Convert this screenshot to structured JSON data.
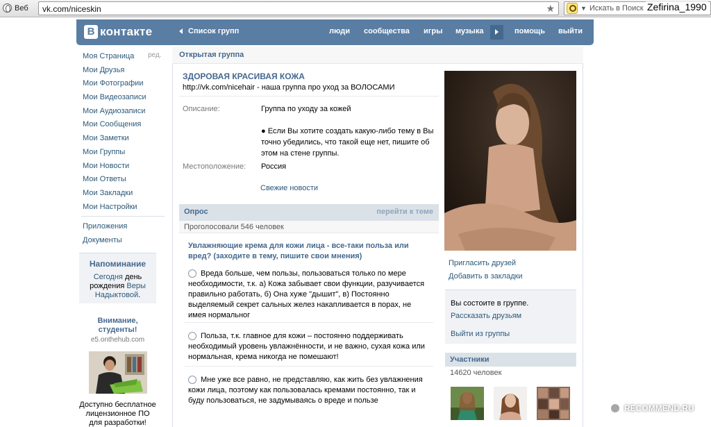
{
  "browser": {
    "web_label": "Веб",
    "url": "vk.com/niceskin",
    "search_placeholder": "Искать в Поиск",
    "user": "Zefirina_1990"
  },
  "header": {
    "logo_text": "контакте",
    "logo_mark": "В",
    "group_list": "Список групп",
    "nav": [
      "люди",
      "сообщества",
      "игры",
      "музыка",
      "помощь",
      "выйти"
    ]
  },
  "sidebar": {
    "edit": "ред.",
    "items": [
      "Моя Страница",
      "Мои Друзья",
      "Мои Фотографии",
      "Мои Видеозаписи",
      "Мои Аудиозаписи",
      "Мои Сообщения",
      "Мои Заметки",
      "Мои Группы",
      "Мои Новости",
      "Мои Ответы",
      "Мои Закладки",
      "Мои Настройки"
    ],
    "items2": [
      "Приложения",
      "Документы"
    ],
    "reminder": {
      "title": "Напоминание",
      "today": "Сегодня",
      "birthday": "день рождения",
      "name": "Веры Надыктовой",
      "dot": "."
    },
    "ad": {
      "title": "Внимание, студенты!",
      "domain": "e5.onthehub.com",
      "text": "Доступно бесплатное лицензионное ПО для разработки!"
    }
  },
  "group": {
    "type": "Открытая группа",
    "title": "ЗДОРОВАЯ КРАСИВАЯ КОЖА",
    "subtitle": "http://vk.com/nicehair - наша группа про уход за ВОЛОСАМИ",
    "description_label": "Описание:",
    "description_1": "Группа по уходу за кожей",
    "description_2": "● Если Вы хотите создать какую-либо тему в Вы точно убедились, что такой еще нет, пишите об этом на стене группы.",
    "location_label": "Местоположение:",
    "location": "Россия",
    "news_link": "Свежие новости"
  },
  "poll": {
    "header": "Опрос",
    "goto_topic": "перейти к теме",
    "votes": "Проголосовали 546 человек",
    "question": "Увлажняющие крема для кожи лица - все-таки польза или вред? (заходите в тему, пишите свои мнения)",
    "options": [
      "Вреда больше, чем пользы, пользоваться только по мере необходимости, т.к. а) Кожа забывает свои функции, разучивается правильно работать, б) Она хуже \"дышит\", в) Постоянно выделяемый секрет сальных желез накапливается в порах, не имея нормальног",
      "Польза, т.к. главное для кожи – постоянно поддерживать необходимый уровень увлажнённости, и не важно, сухая кожа или нормальная, крема никогда не помешают!",
      "Мне уже все равно, не представляю, как жить без увлажнения кожи лица, поэтому как пользовалась кремами постоянно, так и буду пользоваться, не задумываясь о вреде и пользе"
    ]
  },
  "right": {
    "invite": "Пригласить друзей",
    "bookmark": "Добавить в закладки",
    "member_status": "Вы состоите в группе.",
    "tell_friends": "Рассказать друзьям",
    "leave": "Выйти из группы",
    "members_title": "Участники",
    "members_count": "14620 человек"
  },
  "watermark": "RECOMMEND.RU",
  "colors": {
    "header_bg": "#597da3",
    "link": "#2b587a",
    "title": "#45688e"
  }
}
